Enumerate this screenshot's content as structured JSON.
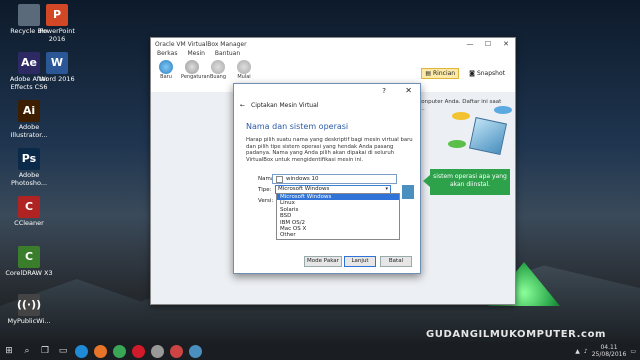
{
  "desktop": {
    "icons": [
      {
        "label": "Recycle Bin",
        "icon": "recycle-bin-icon",
        "color": "#5a6a7a"
      },
      {
        "label": "PowerPoint 2016",
        "icon": "powerpoint-icon",
        "color": "#d24726",
        "glyph": "P"
      },
      {
        "label": "Adobe After Effects CS6",
        "icon": "after-effects-icon",
        "color": "#2d2a63",
        "glyph": "Ae"
      },
      {
        "label": "Word 2016",
        "icon": "word-icon",
        "color": "#2b5797",
        "glyph": "W"
      },
      {
        "label": "Adobe Illustrator...",
        "icon": "illustrator-icon",
        "color": "#3d1f00",
        "glyph": "Ai"
      },
      {
        "label": "Adobe Photosho...",
        "icon": "photoshop-icon",
        "color": "#0b2a4a",
        "glyph": "Ps"
      },
      {
        "label": "CCleaner",
        "icon": "ccleaner-icon",
        "color": "#b02323",
        "glyph": "C"
      },
      {
        "label": "CorelDRAW X3",
        "icon": "coreldraw-icon",
        "color": "#3a7d2a",
        "glyph": "C"
      },
      {
        "label": "MyPublicWi...",
        "icon": "wifi-icon",
        "color": "#444",
        "glyph": "((·))"
      }
    ]
  },
  "virtualbox": {
    "title": "Oracle VM VirtualBox Manager",
    "menu": [
      "Berkas",
      "Mesin",
      "Bantuan"
    ],
    "toolbar": [
      "Baru",
      "Pengaturan",
      "Buang",
      "Mulai"
    ],
    "right_tools": [
      "Rincian",
      "Snapshot"
    ],
    "welcome_text": "...konputer Anda. Daftar ini saat ini..."
  },
  "dialog": {
    "header": "Ciptakan Mesin Virtual",
    "help": "?",
    "close": "✕",
    "back": "←",
    "title": "Nama dan sistem operasi",
    "description": "Harap pilih suatu nama yang deskriptif bagi mesin virtual baru dan pilih tipe sistem operasi yang hendak Anda pasang padanya. Nama yang Anda pilih akan dipakai di seluruh VirtualBox untuk mengidentifikasi mesin ini.",
    "name_label": "Nama:",
    "name_value": "windows 10",
    "type_label": "Tipe:",
    "type_value": "Microsoft Windows",
    "version_label": "Versi:",
    "type_options": [
      "Microsoft Windows",
      "Linux",
      "Solaris",
      "BSD",
      "IBM OS/2",
      "Mac OS X",
      "Other"
    ],
    "buttons": {
      "expert": "Mode Pakar",
      "next": "Lanjut",
      "cancel": "Batal"
    }
  },
  "callout": {
    "text": "sistem operasi apa yang akan diinstal."
  },
  "taskbar": {
    "time": "04.11",
    "date": "25/08/2016"
  },
  "watermark": "GUDANGILMUKOMPUTER.com"
}
